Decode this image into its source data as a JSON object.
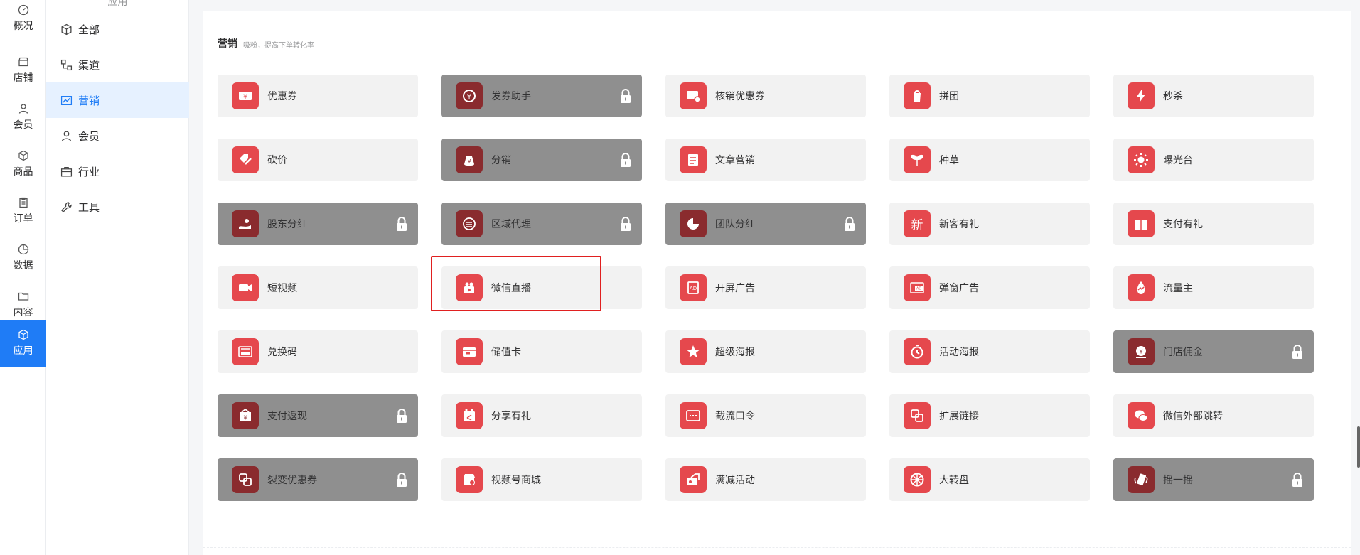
{
  "rail": {
    "items": [
      {
        "label": "概况",
        "icon": "dashboard-icon"
      },
      {
        "label": "店铺",
        "icon": "store-icon"
      },
      {
        "label": "会员",
        "icon": "user-icon"
      },
      {
        "label": "商品",
        "icon": "box-icon"
      },
      {
        "label": "订单",
        "icon": "clipboard-icon"
      },
      {
        "label": "数据",
        "icon": "pie-icon"
      },
      {
        "label": "内容",
        "icon": "folder-icon"
      },
      {
        "label": "应用",
        "icon": "cube-icon",
        "active": true
      }
    ]
  },
  "sub": {
    "header": "应用",
    "items": [
      {
        "label": "全部",
        "icon": "cube-icon"
      },
      {
        "label": "渠道",
        "icon": "channel-icon"
      },
      {
        "label": "营销",
        "icon": "trend-icon",
        "active": true
      },
      {
        "label": "会员",
        "icon": "user-icon"
      },
      {
        "label": "行业",
        "icon": "briefcase-icon"
      },
      {
        "label": "工具",
        "icon": "wrench-icon"
      }
    ]
  },
  "section": {
    "title": "营销",
    "subtitle": "吸粉，提高下单转化率"
  },
  "apps": [
    [
      {
        "label": "优惠券",
        "icon": "coupon-icon",
        "locked": false
      },
      {
        "label": "发券助手",
        "icon": "coupon-helper-icon",
        "locked": true
      },
      {
        "label": "核销优惠券",
        "icon": "verify-coupon-icon",
        "locked": false
      },
      {
        "label": "拼团",
        "icon": "group-buy-icon",
        "locked": false
      },
      {
        "label": "秒杀",
        "icon": "flash-icon",
        "locked": false
      }
    ],
    [
      {
        "label": "砍价",
        "icon": "bargain-icon",
        "locked": false
      },
      {
        "label": "分销",
        "icon": "money-bag-icon",
        "locked": true
      },
      {
        "label": "文章营销",
        "icon": "article-icon",
        "locked": false
      },
      {
        "label": "种草",
        "icon": "sprout-icon",
        "locked": false
      },
      {
        "label": "曝光台",
        "icon": "sun-icon",
        "locked": false
      }
    ],
    [
      {
        "label": "股东分红",
        "icon": "dividend-icon",
        "locked": true
      },
      {
        "label": "区域代理",
        "icon": "coins-icon",
        "locked": true
      },
      {
        "label": "团队分红",
        "icon": "pie-chart-icon",
        "locked": true
      },
      {
        "label": "新客有礼",
        "icon": "new-char-icon",
        "locked": false
      },
      {
        "label": "支付有礼",
        "icon": "gift-icon",
        "locked": false
      }
    ],
    [
      {
        "label": "短视频",
        "icon": "video-camera-icon",
        "locked": false
      },
      {
        "label": "微信直播",
        "icon": "live-stream-icon",
        "locked": false,
        "highlighted": true
      },
      {
        "label": "开屏广告",
        "icon": "ad-icon",
        "locked": false
      },
      {
        "label": "弹窗广告",
        "icon": "popup-ad-icon",
        "locked": false
      },
      {
        "label": "流量主",
        "icon": "traffic-icon",
        "locked": false
      }
    ],
    [
      {
        "label": "兑换码",
        "icon": "redeem-code-icon",
        "locked": false
      },
      {
        "label": "储值卡",
        "icon": "stored-card-icon",
        "locked": false
      },
      {
        "label": "超级海报",
        "icon": "star-poster-icon",
        "locked": false
      },
      {
        "label": "活动海报",
        "icon": "stopwatch-icon",
        "locked": false
      },
      {
        "label": "门店佣金",
        "icon": "commission-icon",
        "locked": true
      }
    ],
    [
      {
        "label": "支付返现",
        "icon": "cashback-icon",
        "locked": true
      },
      {
        "label": "分享有礼",
        "icon": "share-gift-icon",
        "locked": false
      },
      {
        "label": "截流口令",
        "icon": "password-icon",
        "locked": false
      },
      {
        "label": "扩展链接",
        "icon": "link-icon",
        "locked": false
      },
      {
        "label": "微信外部跳转",
        "icon": "wechat-icon",
        "locked": false
      }
    ],
    [
      {
        "label": "裂变优惠券",
        "icon": "fission-coupon-icon",
        "locked": true
      },
      {
        "label": "视频号商城",
        "icon": "video-shop-icon",
        "locked": false
      },
      {
        "label": "满减活动",
        "icon": "discount-icon",
        "locked": false
      },
      {
        "label": "大转盘",
        "icon": "wheel-icon",
        "locked": false
      },
      {
        "label": "摇一摇",
        "icon": "shake-icon",
        "locked": true
      }
    ]
  ]
}
